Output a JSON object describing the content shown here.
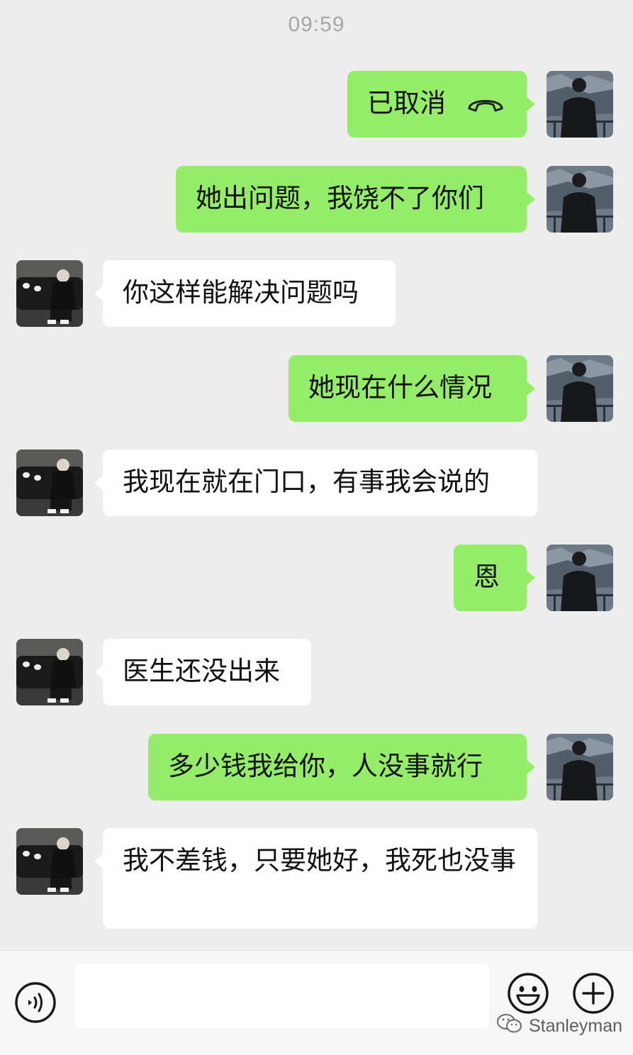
{
  "timestamp": "09:59",
  "messages": [
    {
      "side": "sent",
      "type": "call",
      "text": "已取消"
    },
    {
      "side": "sent",
      "type": "text",
      "text": "她出问题，我饶不了你们"
    },
    {
      "side": "recv",
      "type": "text",
      "text": "你这样能解决问题吗"
    },
    {
      "side": "sent",
      "type": "text",
      "text": "她现在什么情况"
    },
    {
      "side": "recv",
      "type": "text",
      "text": "我现在就在门口，有事我会说的"
    },
    {
      "side": "sent",
      "type": "text",
      "text": "恩"
    },
    {
      "side": "recv",
      "type": "text",
      "text": "医生还没出来"
    },
    {
      "side": "sent",
      "type": "text",
      "text": "多少钱我给你，人没事就行"
    },
    {
      "side": "recv",
      "type": "text",
      "text": "我不差钱，只要她好，我死也没事"
    }
  ],
  "input_bar": {
    "voice_icon": "voice-icon",
    "input_value": "",
    "emoji_icon": "emoji-icon",
    "plus_icon": "plus-icon"
  },
  "watermark": "Stanleyman",
  "colors": {
    "background": "#ededed",
    "sent_bubble": "#95ec69",
    "recv_bubble": "#ffffff",
    "timestamp": "#a6a6a6"
  }
}
